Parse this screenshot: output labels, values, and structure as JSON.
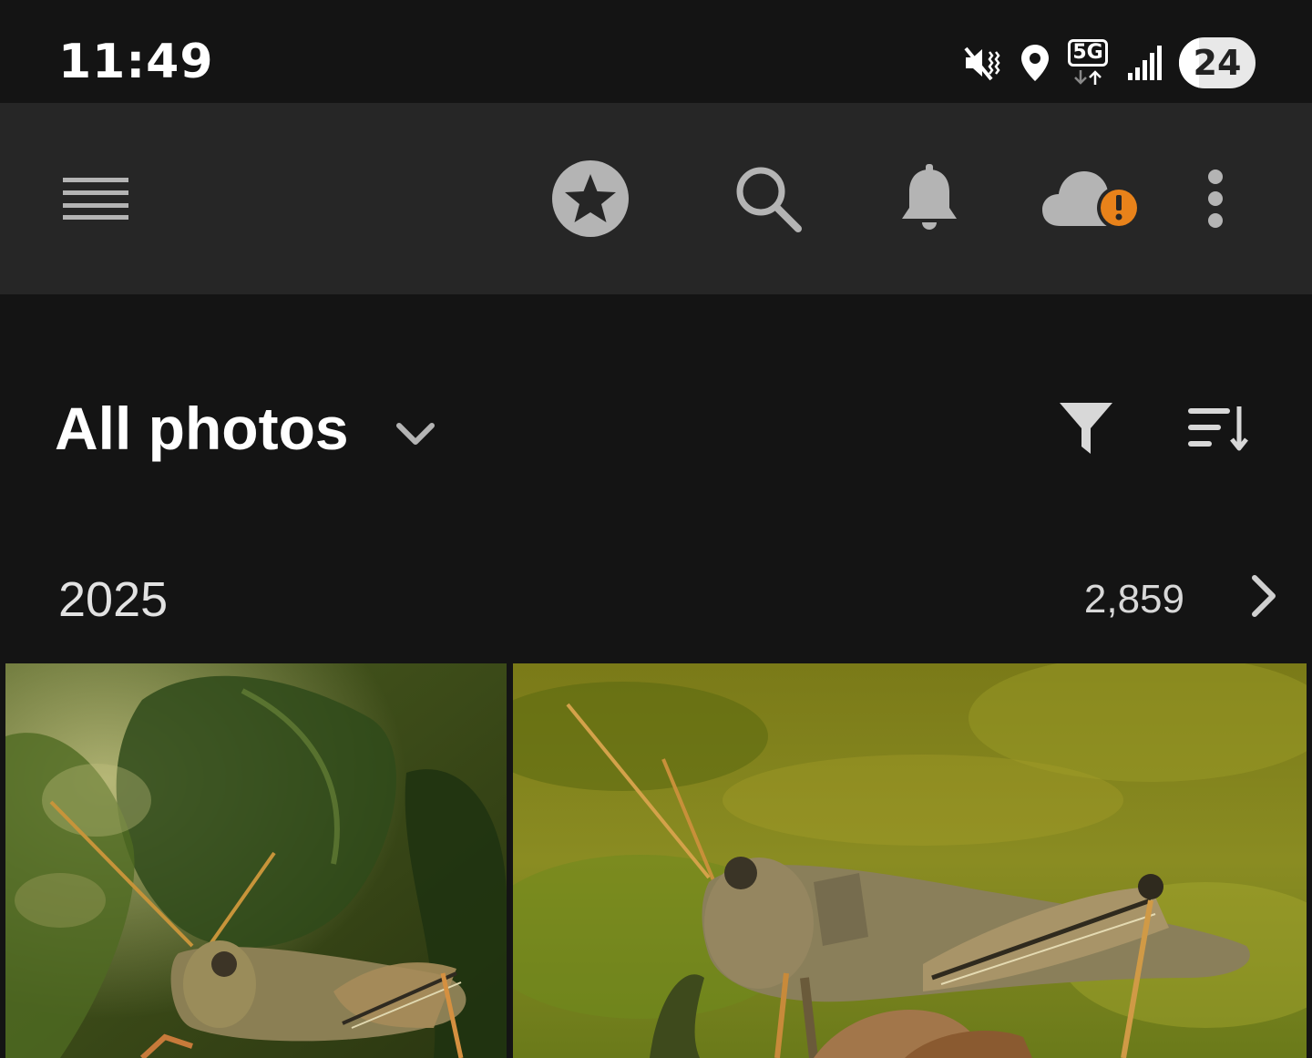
{
  "status_bar": {
    "time": "11:49",
    "network_label": "5G",
    "battery_level": "24",
    "icons": [
      "vibrate-mute-icon",
      "location-icon",
      "5g-data-icon",
      "signal-icon",
      "battery-icon"
    ]
  },
  "toolbar": {
    "icons": [
      "menu-icon",
      "star-badge-icon",
      "search-icon",
      "bell-icon",
      "cloud-alert-icon",
      "more-vert-icon"
    ],
    "alert_color": "#e8821a"
  },
  "header": {
    "title": "All photos",
    "icons": [
      "chevron-down-icon",
      "filter-icon",
      "sort-icon"
    ]
  },
  "year_section": {
    "year": "2025",
    "count": "2,859",
    "icon": "chevron-right-icon"
  },
  "photos": [
    {
      "subject": "grasshopper on leaf"
    },
    {
      "subject": "grasshopper on flower"
    }
  ]
}
